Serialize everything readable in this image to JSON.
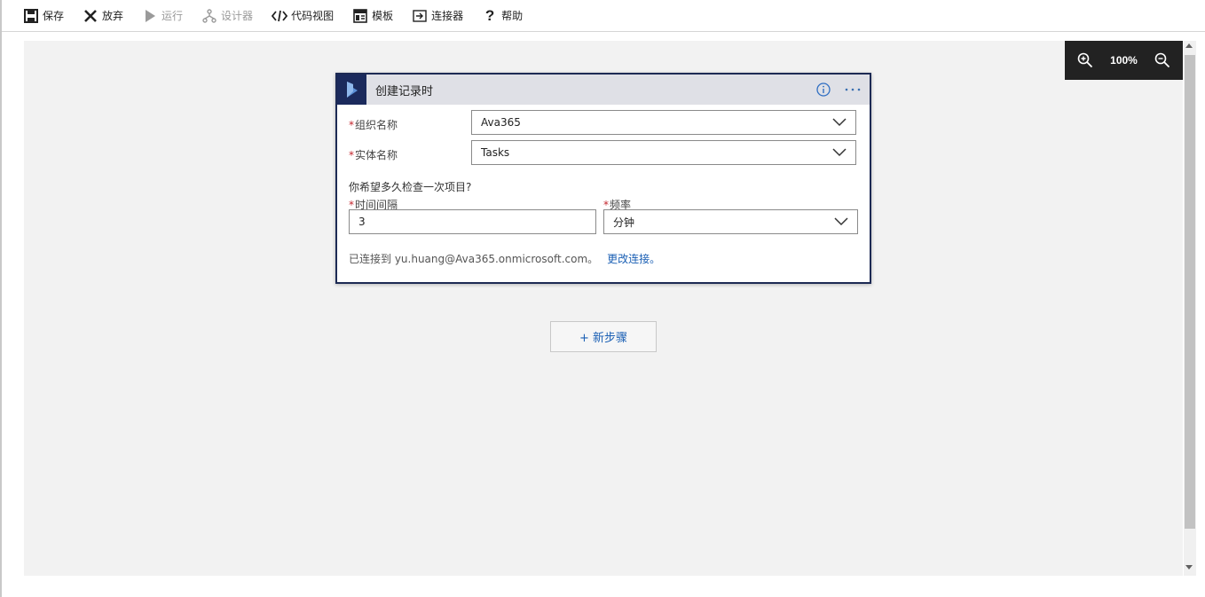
{
  "toolbar": {
    "save": "保存",
    "discard": "放弃",
    "run": "运行",
    "designer": "设计器",
    "code_view": "代码视图",
    "templates": "模板",
    "connectors": "连接器",
    "help": "帮助"
  },
  "zoom": {
    "level": "100%"
  },
  "card": {
    "title": "创建记录时",
    "org_label": "组织名称",
    "org_value": "Ava365",
    "entity_label": "实体名称",
    "entity_value": "Tasks",
    "question": "你希望多久检查一次项目?",
    "interval_label": "时间间隔",
    "interval_value": "3",
    "frequency_label": "频率",
    "frequency_value": "分钟",
    "connected_text": "已连接到 yu.huang@Ava365.onmicrosoft.com。",
    "change_connection": "更改连接。"
  },
  "new_step": {
    "label": "+ 新步骤"
  },
  "colors": {
    "accent": "#1a5fb4",
    "header_dark": "#1b2a5c",
    "required": "#c4262e"
  }
}
